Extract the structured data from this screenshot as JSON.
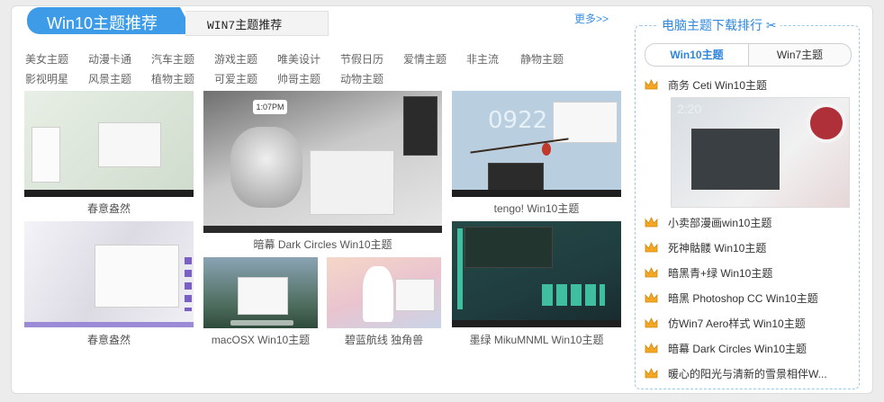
{
  "tabs": {
    "active": "Win10主题推荐",
    "inactive": "WIN7主题推荐"
  },
  "more": "更多>>",
  "categories": [
    "美女主题",
    "动漫卡通",
    "汽车主题",
    "游戏主题",
    "唯美设计",
    "节假日历",
    "爱情主题",
    "非主流",
    "静物主题",
    "影视明星",
    "风景主题",
    "植物主题",
    "可爱主题",
    "帅哥主题",
    "动物主题"
  ],
  "thumbs": {
    "t1": "春意盎然",
    "t2": "暗幕 Dark Circles Win10主题",
    "t2_clock": "1:07PM",
    "t3": "tengo! Win10主题",
    "t3_clock": "0922",
    "t4": "春意盎然",
    "t5": "macOSX Win10主题",
    "t6": "碧蓝航线 独角兽",
    "t7": "墨绿 MikuMNML Win10主题"
  },
  "ranking": {
    "title": "电脑主题下载排行",
    "tab_on": "Win10主题",
    "tab_off": "Win7主题",
    "featured": "商务 Ceti Win10主题",
    "featured_clock": "2:20",
    "items": [
      "小卖部漫画win10主题",
      "死神骷髅 Win10主题",
      "暗黑青+绿 Win10主题",
      "暗黑 Photoshop CC Win10主题",
      "仿Win7 Aero样式 Win10主题",
      "暗幕 Dark Circles Win10主题",
      "暖心的阳光与清新的雪景相伴W..."
    ]
  },
  "colors": {
    "accent": "#3d9be8",
    "crown": "#f5a623",
    "link": "#3a8ee6"
  }
}
